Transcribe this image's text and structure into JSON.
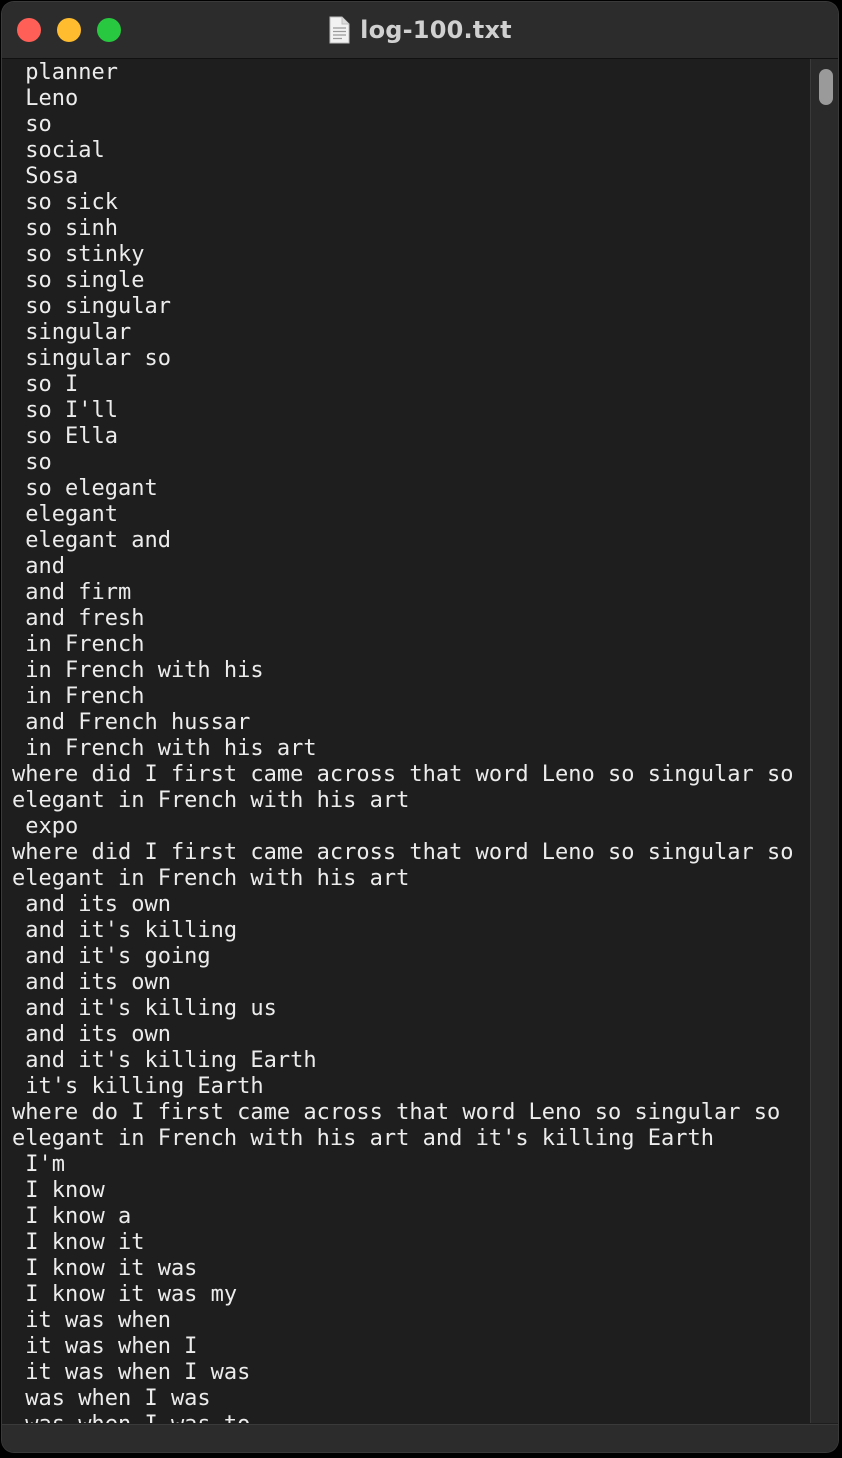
{
  "window": {
    "title": "log-100.txt",
    "icon": "document-icon"
  },
  "colors": {
    "close": "#ff5f57",
    "minimize": "#febc2e",
    "zoom": "#28c840",
    "background": "#1e1e1e",
    "text": "#ececec"
  },
  "lines": [
    " planner",
    " Leno",
    " so",
    " social",
    " Sosa",
    " so sick",
    " so sinh",
    " so stinky",
    " so single",
    " so singular",
    " singular",
    " singular so",
    " so I",
    " so I'll",
    " so Ella",
    " so",
    " so elegant",
    " elegant",
    " elegant and",
    " and",
    " and firm",
    " and fresh",
    " in French",
    " in French with his",
    " in French",
    " and French hussar",
    " in French with his art",
    "where did I first came across that word Leno so singular so",
    "elegant in French with his art",
    " expo",
    "where did I first came across that word Leno so singular so",
    "elegant in French with his art",
    " and its own",
    " and it's killing",
    " and it's going",
    " and its own",
    " and it's killing us",
    " and its own",
    " and it's killing Earth",
    " it's killing Earth",
    "where do I first came across that word Leno so singular so",
    "elegant in French with his art and it's killing Earth",
    " I'm",
    " I know",
    " I know a",
    " I know it",
    " I know it was",
    " I know it was my",
    " it was when",
    " it was when I",
    " it was when I was",
    " was when I was",
    " was when I was to"
  ]
}
